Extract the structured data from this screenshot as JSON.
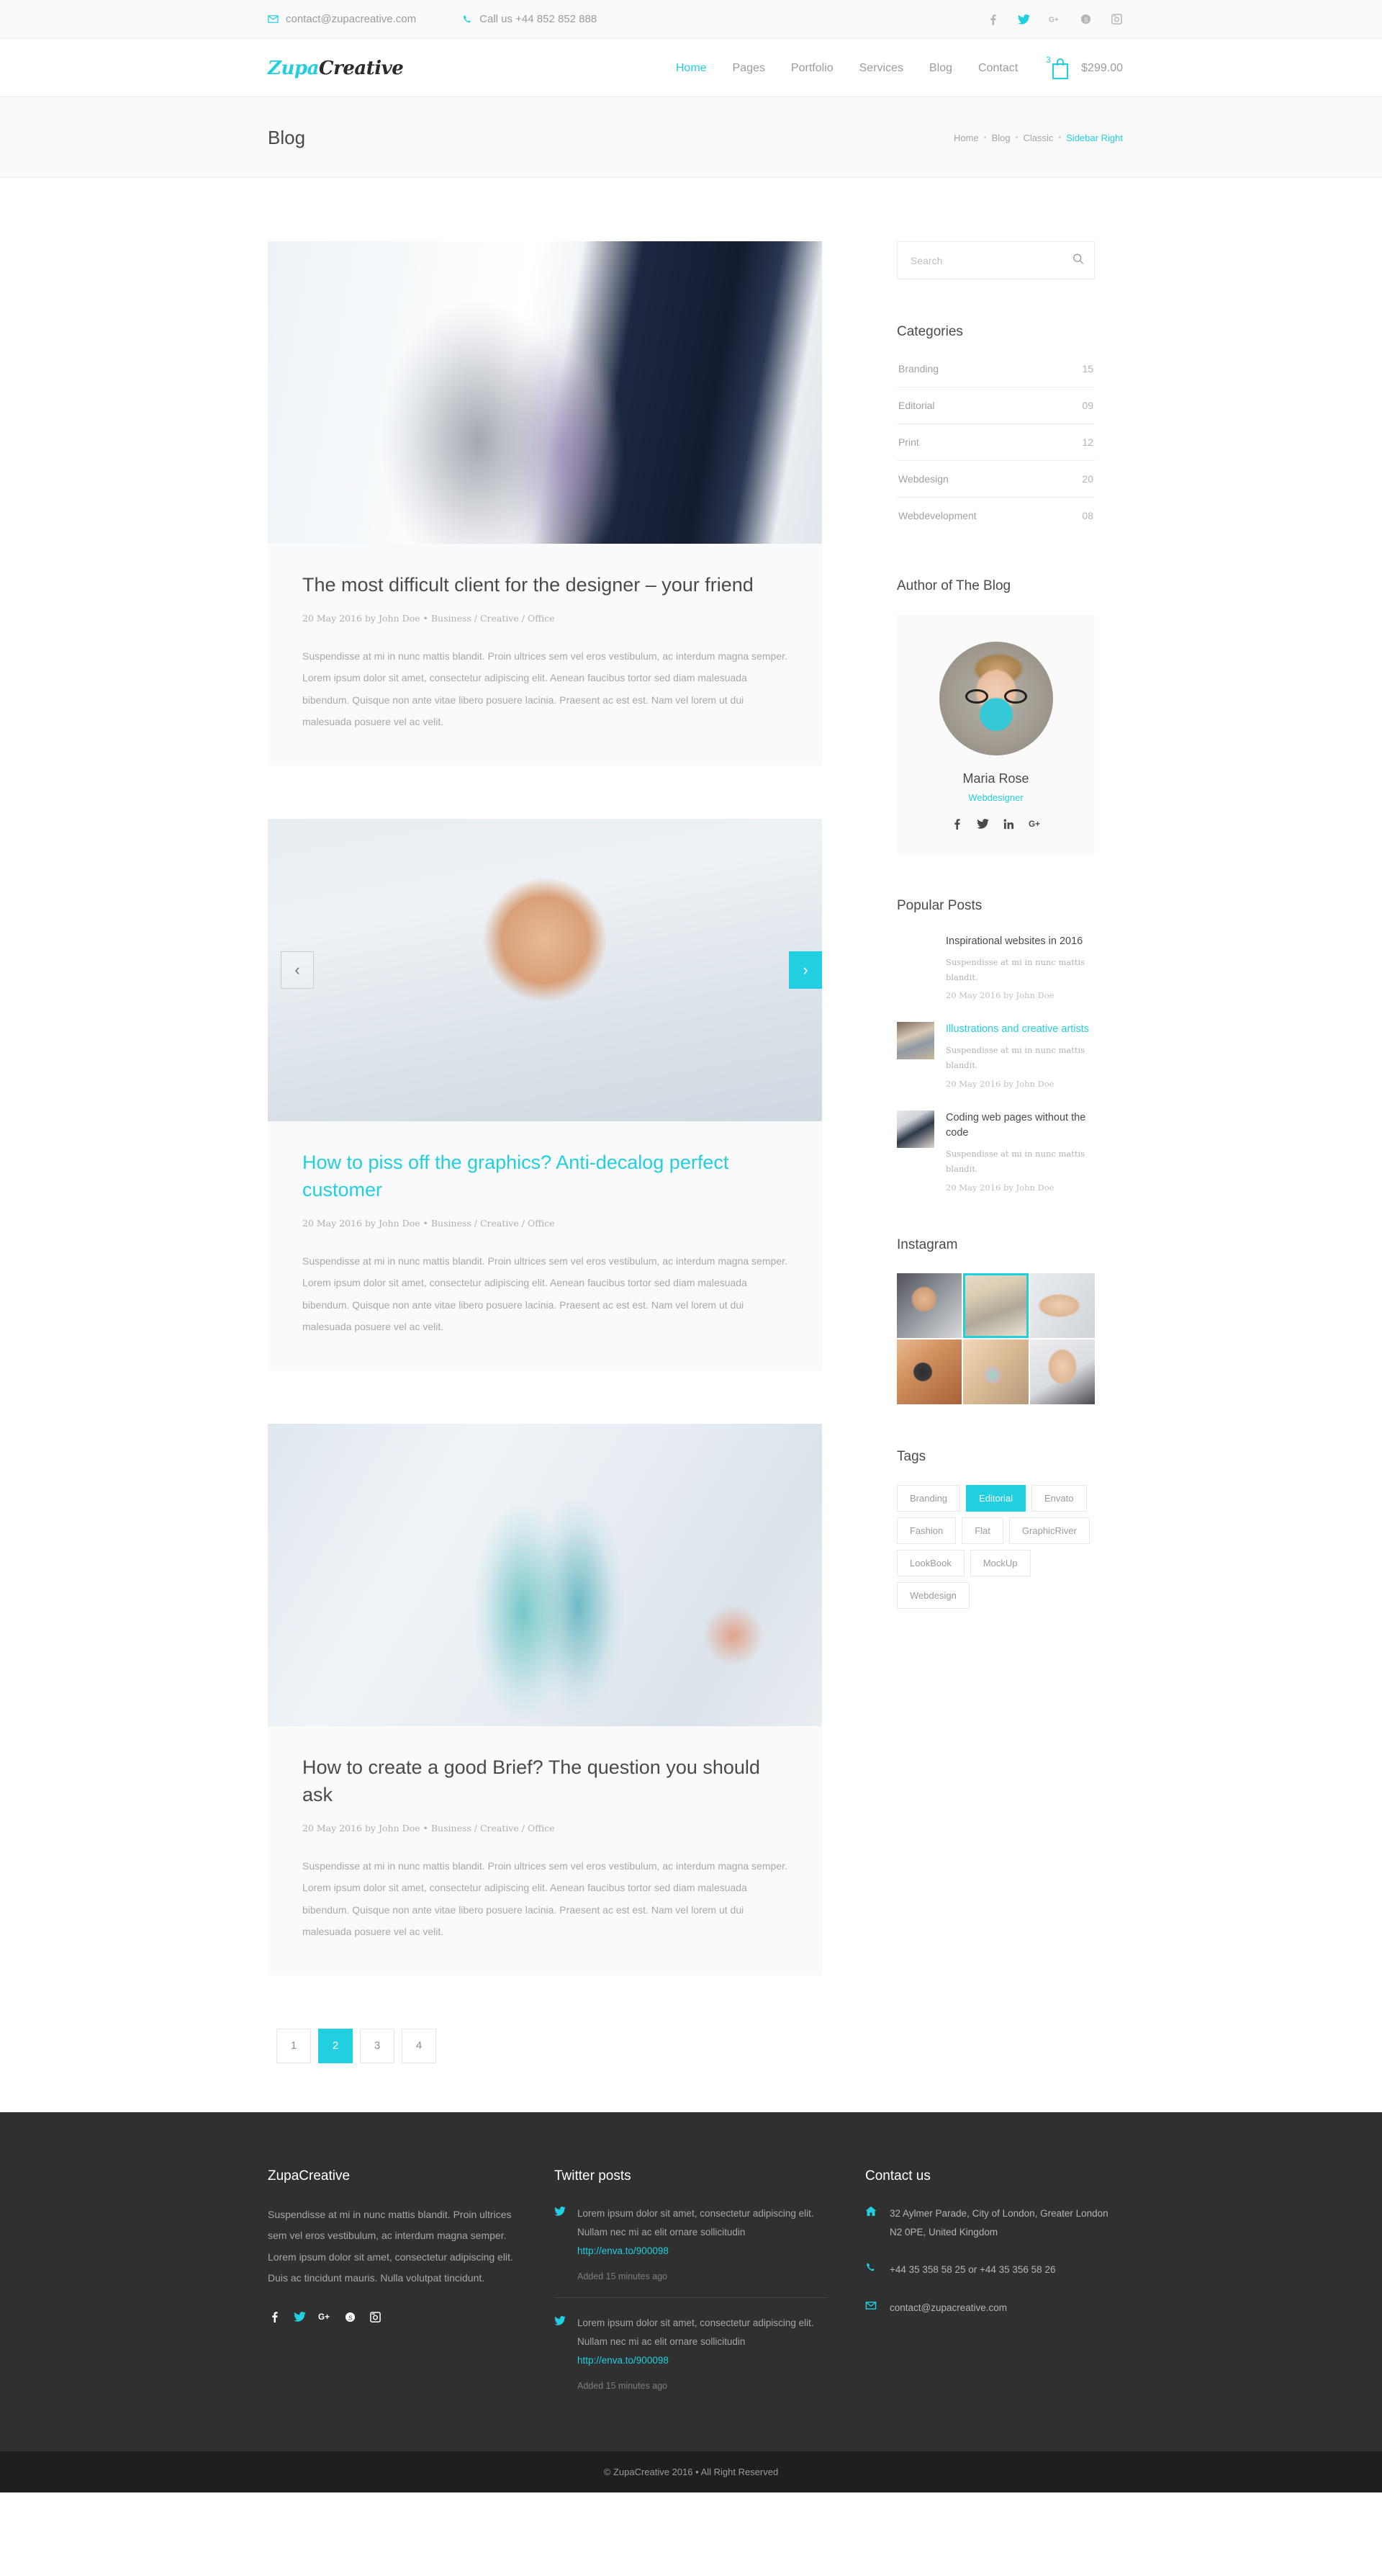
{
  "topbar": {
    "email": "contact@zupacreative.com",
    "phone": "Call us +44 852 852 888",
    "socials": [
      "facebook-icon",
      "twitter-icon",
      "google-plus-icon",
      "skype-icon",
      "instagram-icon"
    ]
  },
  "header": {
    "logo_first": "Zupa",
    "logo_second": "Creative",
    "nav": [
      {
        "label": "Home",
        "active": true
      },
      {
        "label": "Pages",
        "active": false
      },
      {
        "label": "Portfolio",
        "active": false
      },
      {
        "label": "Services",
        "active": false
      },
      {
        "label": "Blog",
        "active": false
      },
      {
        "label": "Contact",
        "active": false
      }
    ],
    "cart_count": "3",
    "cart_price": "$299.00"
  },
  "titlebar": {
    "title": "Blog",
    "breadcrumb": [
      "Home",
      "Blog",
      "Classic",
      "Sidebar Right"
    ],
    "breadcrumb_separator": "•"
  },
  "posts": [
    {
      "title": "The most difficult client for the designer – your friend",
      "title_is_link": false,
      "meta": "20 May 2016 by John Doe • Business / Creative / Office",
      "text": "Suspendisse at mi in nunc mattis blandit. Proin ultrices sem vel eros vestibulum, ac interdum magna semper. Lorem ipsum dolor sit amet, consectetur adipiscing elit. Aenean faucibus tortor sed diam malesuada bibendum. Quisque non ante vitae libero posuere lacinia. Praesent ac est est. Nam vel lorem ut dui malesuada posuere vel ac velit.",
      "image": "office-corridor-blurred-people",
      "has_slider": false
    },
    {
      "title": "How to piss off the graphics? Anti-decalog perfect customer",
      "title_is_link": true,
      "meta": "20 May 2016 by John Doe • Business / Creative / Office",
      "text": "Suspendisse at mi in nunc mattis blandit. Proin ultrices sem vel eros vestibulum, ac interdum magna semper. Lorem ipsum dolor sit amet, consectetur adipiscing elit. Aenean faucibus tortor sed diam malesuada bibendum. Quisque non ante vitae libero posuere lacinia. Praesent ac est est. Nam vel lorem ut dui malesuada posuere vel ac velit.",
      "image": "man-holding-picture-frame",
      "has_slider": true,
      "prev_label": "‹",
      "next_label": "›"
    },
    {
      "title": "How to create a good Brief? The question you should ask",
      "title_is_link": false,
      "meta": "20 May 2016 by John Doe • Business / Creative / Office",
      "text": "Suspendisse at mi in nunc mattis blandit. Proin ultrices sem vel eros vestibulum, ac interdum magna semper. Lorem ipsum dolor sit amet, consectetur adipiscing elit. Aenean faucibus tortor sed diam malesuada bibendum. Quisque non ante vitae libero posuere lacinia. Praesent ac est est. Nam vel lorem ut dui malesuada posuere vel ac velit.",
      "image": "office-colleagues-walking",
      "has_slider": false
    }
  ],
  "pagination": [
    {
      "label": "1",
      "active": false
    },
    {
      "label": "2",
      "active": true
    },
    {
      "label": "3",
      "active": false
    },
    {
      "label": "4",
      "active": false
    }
  ],
  "sidebar": {
    "search": {
      "placeholder": "Search",
      "value": ""
    },
    "categories": {
      "title": "Categories",
      "items": [
        {
          "label": "Branding",
          "count": "15"
        },
        {
          "label": "Editorial",
          "count": "09"
        },
        {
          "label": "Print",
          "count": "12"
        },
        {
          "label": "Webdesign",
          "count": "20"
        },
        {
          "label": "Webdevelopment",
          "count": "08"
        }
      ]
    },
    "author": {
      "title": "Author of The Blog",
      "name": "Maria Rose",
      "role": "Webdesigner",
      "socials": [
        "facebook-icon",
        "twitter-icon",
        "linkedin-icon",
        "google-plus-icon"
      ]
    },
    "popular": {
      "title": "Popular Posts",
      "items": [
        {
          "title": "Inspirational websites in 2016",
          "is_link": false,
          "excerpt": "Suspendisse at mi in nunc mattis blandit.",
          "date": "20 May 2016 by John Doe"
        },
        {
          "title": "Illustrations and creative artists",
          "is_link": true,
          "excerpt": "Suspendisse at mi in nunc mattis blandit.",
          "date": "20 May 2016 by John Doe"
        },
        {
          "title": "Coding web pages without the code",
          "is_link": false,
          "excerpt": "Suspendisse at mi in nunc mattis blandit.",
          "date": "20 May 2016 by John Doe"
        }
      ]
    },
    "instagram": {
      "title": "Instagram",
      "cells": [
        {
          "name": "man-in-office",
          "selected": false
        },
        {
          "name": "interior-construction",
          "selected": true
        },
        {
          "name": "hand-on-laptop",
          "selected": false
        },
        {
          "name": "woman-with-camera",
          "selected": false
        },
        {
          "name": "soap-bubbles",
          "selected": false
        },
        {
          "name": "woman-with-moustache",
          "selected": false
        }
      ]
    },
    "tags": {
      "title": "Tags",
      "items": [
        {
          "label": "Branding",
          "active": false
        },
        {
          "label": "Editorial",
          "active": true
        },
        {
          "label": "Envato",
          "active": false
        },
        {
          "label": "Fashion",
          "active": false
        },
        {
          "label": "Flat",
          "active": false
        },
        {
          "label": "GraphicRiver",
          "active": false
        },
        {
          "label": "LookBook",
          "active": false
        },
        {
          "label": "MockUp",
          "active": false
        },
        {
          "label": "Webdesign",
          "active": false
        }
      ]
    }
  },
  "footer": {
    "about": {
      "title": "ZupaCreative",
      "text": "Suspendisse at mi in nunc mattis blandit. Proin ultrices sem vel eros vestibulum, ac interdum magna semper. Lorem ipsum dolor sit amet, consectetur adipiscing elit. Duis ac tincidunt mauris. Nulla volutpat tincidunt.",
      "socials": [
        "facebook-icon",
        "twitter-icon",
        "google-plus-icon",
        "skype-icon",
        "instagram-icon"
      ]
    },
    "twitter": {
      "title": "Twitter posts",
      "items": [
        {
          "text": "Lorem ipsum dolor sit amet, consectetur adipiscing elit. Nullam nec mi ac elit ornare sollicitudin ",
          "link": "http://enva.to/900098",
          "added": "Added 15 minutes ago"
        },
        {
          "text": "Lorem ipsum dolor sit amet, consectetur adipiscing elit. Nullam nec mi ac elit ornare sollicitudin ",
          "link": "http://enva.to/900098",
          "added": "Added 15 minutes ago"
        }
      ]
    },
    "contact": {
      "title": "Contact us",
      "address": "32 Aylmer Parade, City of London, Greater London N2 0PE, United Kingdom",
      "phone": "+44 35 358 58 25 or +44 35 356 58 26",
      "email": "contact@zupacreative.com"
    },
    "copyright": "© ZupaCreative 2016 • All Right Reserved"
  }
}
